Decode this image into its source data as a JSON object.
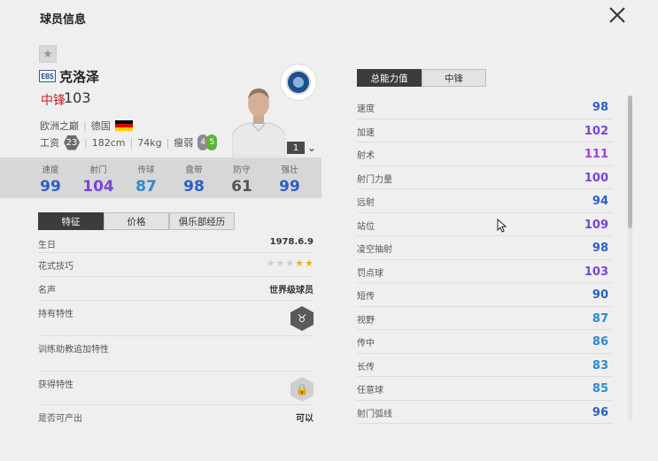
{
  "window": {
    "title": "球员信息"
  },
  "player": {
    "season_badge": "EBS",
    "name": "克洛泽",
    "position": "中锋",
    "overall": "103",
    "league": "欧洲之巅",
    "nationality": "德国",
    "salary_label": "工资",
    "salary": "23",
    "height": "182cm",
    "weight": "74kg",
    "body_type": "瘦弱",
    "weak_foot": "4",
    "strong_foot": "5",
    "level": "1"
  },
  "summary_stats": [
    {
      "label": "速度",
      "value": "99",
      "color": "#2d5fc4"
    },
    {
      "label": "射门",
      "value": "104",
      "color": "#7a45d6"
    },
    {
      "label": "传球",
      "value": "87",
      "color": "#2b8bcf"
    },
    {
      "label": "盘带",
      "value": "98",
      "color": "#2d5fc4"
    },
    {
      "label": "防守",
      "value": "61",
      "color": "#555555"
    },
    {
      "label": "强壮",
      "value": "99",
      "color": "#2d5fc4"
    }
  ],
  "left_tabs": [
    "特征",
    "价格",
    "俱乐部经历"
  ],
  "info": {
    "birthday_label": "生日",
    "birthday": "1978.6.9",
    "skill_label": "花式技巧",
    "skill_stars_total": 5,
    "skill_stars_filled": 2,
    "reputation_label": "名声",
    "reputation": "世界级球员",
    "traits_label": "持有特性",
    "train_traits_label": "训练助教追加特性",
    "obtain_traits_label": "获得特性",
    "producible_label": "是否可产出",
    "producible": "可以"
  },
  "right_tabs": [
    "总能力值",
    "中锋"
  ],
  "attributes": [
    {
      "label": "速度",
      "value": "98",
      "color": "#2d5fc4"
    },
    {
      "label": "加速",
      "value": "102",
      "color": "#7a45d6"
    },
    {
      "label": "射术",
      "value": "111",
      "color": "#a63fd8"
    },
    {
      "label": "射门力量",
      "value": "100",
      "color": "#7a45d6"
    },
    {
      "label": "远射",
      "value": "94",
      "color": "#2d5fc4"
    },
    {
      "label": "站位",
      "value": "109",
      "color": "#7a45d6"
    },
    {
      "label": "凌空抽射",
      "value": "98",
      "color": "#2d5fc4"
    },
    {
      "label": "罚点球",
      "value": "103",
      "color": "#7a45d6"
    },
    {
      "label": "短传",
      "value": "90",
      "color": "#2d5fc4"
    },
    {
      "label": "视野",
      "value": "87",
      "color": "#2b8bcf"
    },
    {
      "label": "传中",
      "value": "86",
      "color": "#2b8bcf"
    },
    {
      "label": "长传",
      "value": "83",
      "color": "#2b8bcf"
    },
    {
      "label": "任意球",
      "value": "85",
      "color": "#2b8bcf"
    },
    {
      "label": "射门弧线",
      "value": "96",
      "color": "#2d5fc4"
    }
  ],
  "icons": {
    "close": "close-icon",
    "favorite": "star-icon",
    "trait": "bull-icon",
    "locked_trait": "lock-icon"
  }
}
